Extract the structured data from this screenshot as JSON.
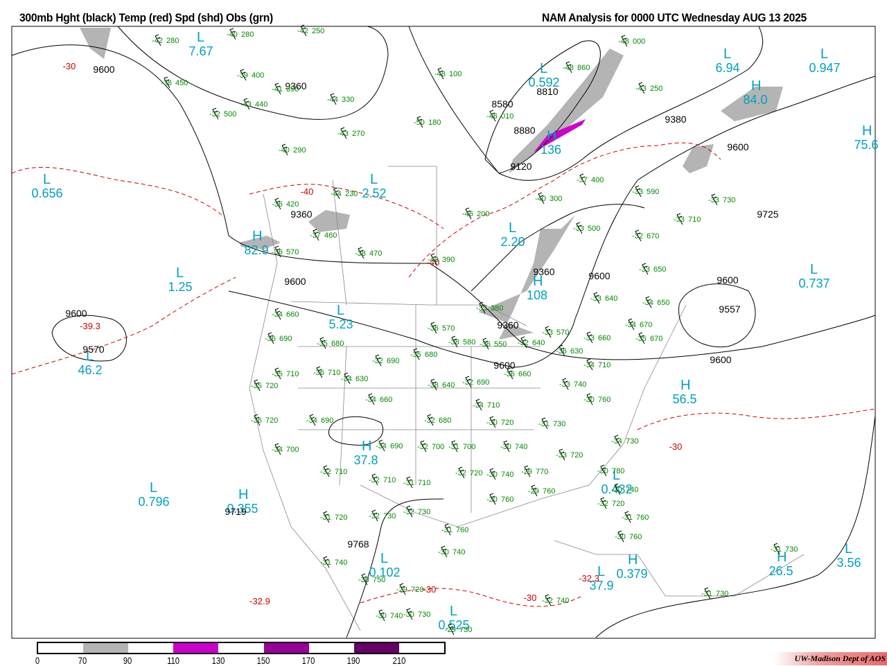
{
  "header": {
    "left_title": "300mb Hght (black) Temp (red) Spd (shd) Obs (grn)",
    "right_title": "NAM Analysis for 0000 UTC Wednesday  AUG 13 2025"
  },
  "legend": {
    "ticks": [
      "0",
      "70",
      "90",
      "110",
      "130",
      "150",
      "170",
      "190",
      "210"
    ],
    "colors": [
      "#ffffff",
      "#b4b4b4",
      "#ffffff",
      "#cc00cc",
      "#ffffff",
      "#990099",
      "#ffffff",
      "#660066",
      "#ffffff"
    ]
  },
  "credit": "UW-Madison  Dept of AOS",
  "colors": {
    "height": "#000000",
    "temp": "#cc0000",
    "obs": "#008800",
    "centers": "#00a0c0",
    "jet": "#b4b4b4",
    "jet_core": "#cc00cc"
  },
  "centers": [
    {
      "type": "L",
      "value": "7.67"
    },
    {
      "type": "L",
      "value": "6.94"
    },
    {
      "type": "L",
      "value": "0.947"
    },
    {
      "type": "H",
      "value": "84.0"
    },
    {
      "type": "H",
      "value": "75.6"
    },
    {
      "type": "L",
      "value": "0.656"
    },
    {
      "type": "L",
      "value": "2.52"
    },
    {
      "type": "L",
      "value": "0.592"
    },
    {
      "type": "H",
      "value": "136"
    },
    {
      "type": "L",
      "value": "2.20"
    },
    {
      "type": "H",
      "value": "82.9"
    },
    {
      "type": "L",
      "value": "1.25"
    },
    {
      "type": "H",
      "value": "108"
    },
    {
      "type": "L",
      "value": "0.737"
    },
    {
      "type": "L",
      "value": "5.23"
    },
    {
      "type": "L",
      "value": "46.2"
    },
    {
      "type": "H",
      "value": "56.5"
    },
    {
      "type": "H",
      "value": "37.8"
    },
    {
      "type": "L",
      "value": "0.796"
    },
    {
      "type": "H",
      "value": "0.355"
    },
    {
      "type": "L",
      "value": "0.432"
    },
    {
      "type": "L",
      "value": "0.102"
    },
    {
      "type": "L",
      "value": "37.9"
    },
    {
      "type": "H",
      "value": "0.379"
    },
    {
      "type": "H",
      "value": "26.5"
    },
    {
      "type": "L",
      "value": "3.56"
    },
    {
      "type": "L",
      "value": "0.525"
    }
  ],
  "height_labels": [
    "9600",
    "9360",
    "8810",
    "8580",
    "8880",
    "9380",
    "9600",
    "9120",
    "9360",
    "9725",
    "9360",
    "9600",
    "9600",
    "9600",
    "9557",
    "9600",
    "9570",
    "9360",
    "9600",
    "9600",
    "9719",
    "9768"
  ],
  "temp_labels": [
    "-30",
    "-40",
    "-40",
    "-39.3",
    "-30",
    "-30",
    "-32.3",
    "-32.9",
    "-30"
  ],
  "observations": [
    {
      "t": "-42",
      "h": "280"
    },
    {
      "t": "-40",
      "h": "280"
    },
    {
      "t": "-42",
      "h": "250"
    },
    {
      "t": "-48",
      "h": "000"
    },
    {
      "t": "-48",
      "h": "100"
    },
    {
      "t": "-48",
      "h": "860"
    },
    {
      "t": "-39",
      "h": "400"
    },
    {
      "t": "-38",
      "h": "450"
    },
    {
      "t": "-41",
      "h": "390"
    },
    {
      "t": "-44",
      "h": "330"
    },
    {
      "t": "-43",
      "h": "250"
    },
    {
      "t": "-43",
      "h": "440"
    },
    {
      "t": "-32",
      "h": "500"
    },
    {
      "t": "-46",
      "h": "010"
    },
    {
      "t": "-50",
      "h": "180"
    },
    {
      "t": "-43",
      "h": "270"
    },
    {
      "t": "-40",
      "h": "290"
    },
    {
      "t": "-37",
      "h": "400"
    },
    {
      "t": "-44",
      "h": "230"
    },
    {
      "t": "-33",
      "h": "590"
    },
    {
      "t": "-40",
      "h": "300"
    },
    {
      "t": "-33",
      "h": "730"
    },
    {
      "t": "-46",
      "h": "200"
    },
    {
      "t": "-36",
      "h": "420"
    },
    {
      "t": "-33",
      "h": "710"
    },
    {
      "t": "-33",
      "h": "500"
    },
    {
      "t": "-37",
      "h": "460"
    },
    {
      "t": "-32",
      "h": "670"
    },
    {
      "t": "-36",
      "h": "570"
    },
    {
      "t": "-38",
      "h": "470"
    },
    {
      "t": "-40",
      "h": "390"
    },
    {
      "t": "-33",
      "h": "650"
    },
    {
      "t": "-39",
      "h": "380"
    },
    {
      "t": "-33",
      "h": "640"
    },
    {
      "t": "-34",
      "h": "650"
    },
    {
      "t": "-34",
      "h": "660"
    },
    {
      "t": "-34",
      "h": "670"
    },
    {
      "t": "-36",
      "h": "570"
    },
    {
      "t": "-33",
      "h": "570"
    },
    {
      "t": "-33",
      "h": "660"
    },
    {
      "t": "-35",
      "h": "670"
    },
    {
      "t": "-36",
      "h": "690"
    },
    {
      "t": "-35",
      "h": "680"
    },
    {
      "t": "-38",
      "h": "580"
    },
    {
      "t": "-36",
      "h": "550"
    },
    {
      "t": "-32",
      "h": "640"
    },
    {
      "t": "-36",
      "h": "630"
    },
    {
      "t": "-35",
      "h": "680"
    },
    {
      "t": "-32",
      "h": "690"
    },
    {
      "t": "-34",
      "h": "710"
    },
    {
      "t": "-35",
      "h": "710"
    },
    {
      "t": "-36",
      "h": "710"
    },
    {
      "t": "-34",
      "h": "630"
    },
    {
      "t": "-36",
      "h": "660"
    },
    {
      "t": "-38",
      "h": "640"
    },
    {
      "t": "-32",
      "h": "690"
    },
    {
      "t": "-33",
      "h": "740"
    },
    {
      "t": "-35",
      "h": "720"
    },
    {
      "t": "-34",
      "h": "660"
    },
    {
      "t": "-34",
      "h": "710"
    },
    {
      "t": "-36",
      "h": "720"
    },
    {
      "t": "-34",
      "h": "690"
    },
    {
      "t": "-32",
      "h": "680"
    },
    {
      "t": "-30",
      "h": "720"
    },
    {
      "t": "-31",
      "h": "730"
    },
    {
      "t": "-30",
      "h": "760"
    },
    {
      "t": "-34",
      "h": "730"
    },
    {
      "t": "-34",
      "h": "700"
    },
    {
      "t": "-34",
      "h": "690"
    },
    {
      "t": "-32",
      "h": "700"
    },
    {
      "t": "-31",
      "h": "700"
    },
    {
      "t": "-30",
      "h": "740"
    },
    {
      "t": "-33",
      "h": "720"
    },
    {
      "t": "-32",
      "h": "710"
    },
    {
      "t": "-32",
      "h": "710"
    },
    {
      "t": "-31",
      "h": "710"
    },
    {
      "t": "-32",
      "h": "720"
    },
    {
      "t": "-30",
      "h": "740"
    },
    {
      "t": "-29",
      "h": "770"
    },
    {
      "t": "-30",
      "h": "780"
    },
    {
      "t": "-30",
      "h": "740"
    },
    {
      "t": "-29",
      "h": "760"
    },
    {
      "t": "-30",
      "h": "760"
    },
    {
      "t": "-32",
      "h": "720"
    },
    {
      "t": "-31",
      "h": "720"
    },
    {
      "t": "-32",
      "h": "730"
    },
    {
      "t": "-32",
      "h": "730"
    },
    {
      "t": "-31",
      "h": "760"
    },
    {
      "t": "-31",
      "h": "760"
    },
    {
      "t": "-30",
      "h": "760"
    },
    {
      "t": "-31",
      "h": "740"
    },
    {
      "t": "-30",
      "h": "750"
    },
    {
      "t": "-29",
      "h": "720"
    },
    {
      "t": "-30",
      "h": "740"
    },
    {
      "t": "-32",
      "h": "740"
    },
    {
      "t": "-31",
      "h": "730"
    },
    {
      "t": "-31",
      "h": "730"
    },
    {
      "t": "-30",
      "h": "740"
    },
    {
      "t": "-30",
      "h": "730"
    },
    {
      "t": "-29",
      "h": "730"
    }
  ]
}
